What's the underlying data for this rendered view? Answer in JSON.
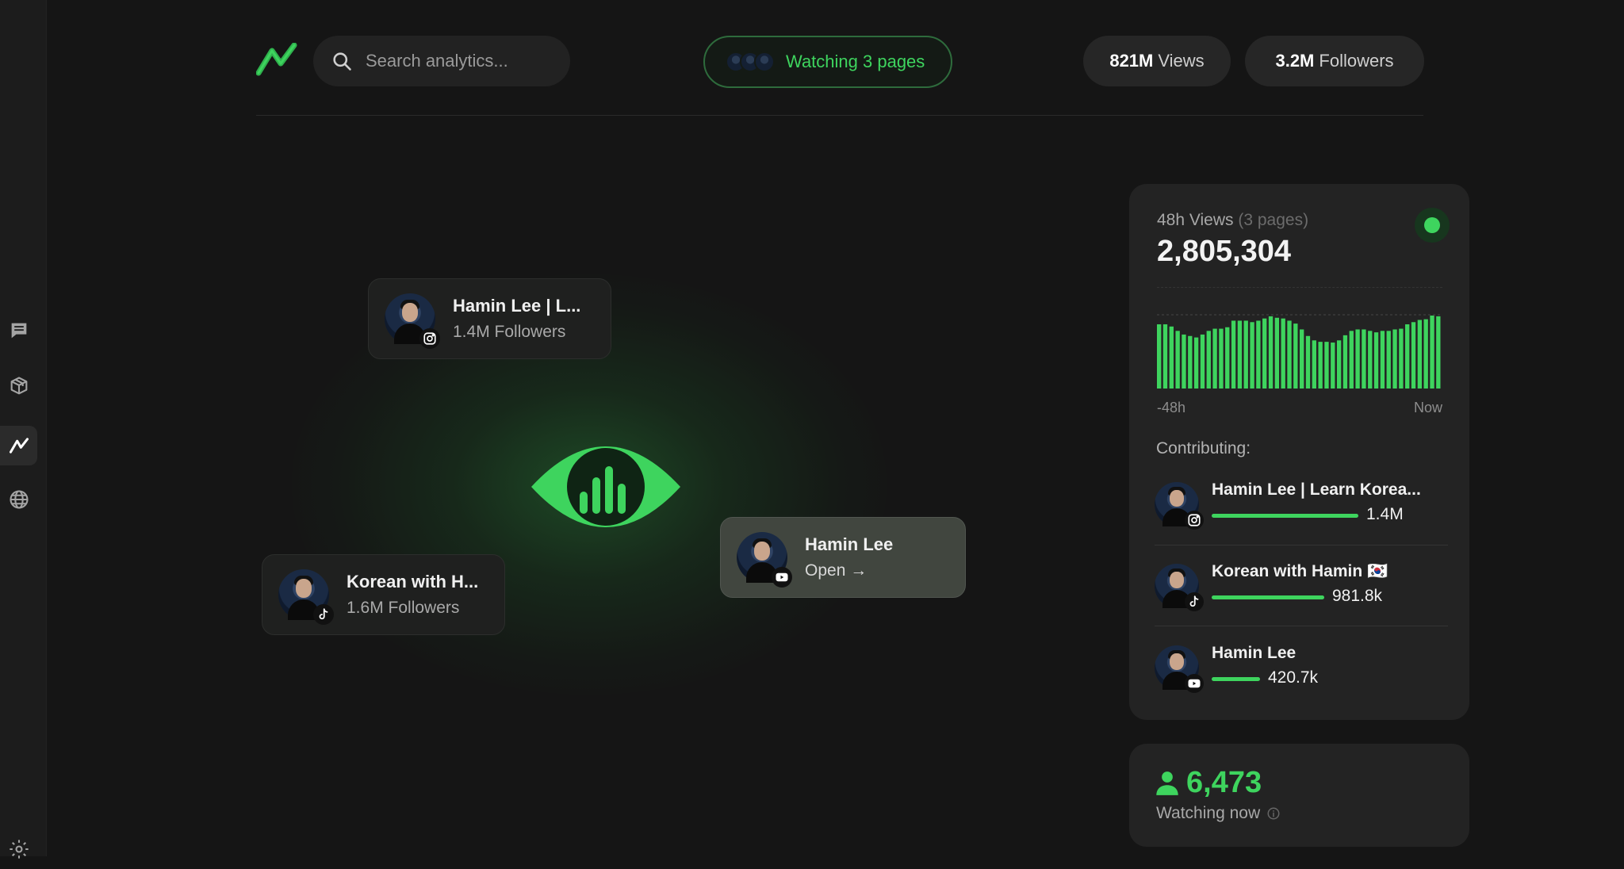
{
  "sidebar": {
    "items": [
      {
        "icon": "chat-icon"
      },
      {
        "icon": "cube-icon"
      },
      {
        "icon": "analytics-icon",
        "active": true
      },
      {
        "icon": "globe-icon"
      },
      {
        "icon": "gear-icon"
      }
    ]
  },
  "header": {
    "search_placeholder": "Search analytics...",
    "watching_label": "Watching 3 pages",
    "views": {
      "value": "821M",
      "label": "Views"
    },
    "followers": {
      "value": "3.2M",
      "label": "Followers"
    }
  },
  "nodes": [
    {
      "title": "Hamin Lee | L...",
      "sub": "1.4M Followers",
      "platform": "instagram-icon"
    },
    {
      "title": "Korean with H...",
      "sub": "1.6M Followers",
      "platform": "tiktok-icon"
    },
    {
      "title": "Hamin Lee",
      "sub": "Open →",
      "platform": "youtube-icon"
    }
  ],
  "panel": {
    "heading": "48h Views",
    "heading_muted": "(3 pages)",
    "total": "2,805,304",
    "axis_start": "-48h",
    "axis_end": "Now",
    "contributing_label": "Contributing:",
    "spark_values": [
      88,
      88,
      85,
      79,
      74,
      72,
      70,
      74,
      79,
      82,
      82,
      84,
      93,
      93,
      93,
      91,
      93,
      96,
      99,
      97,
      96,
      93,
      89,
      81,
      72,
      66,
      64,
      64,
      63,
      66,
      73,
      79,
      81,
      81,
      79,
      77,
      79,
      79,
      81,
      82,
      88,
      91,
      94,
      95,
      100,
      99
    ],
    "contributors": [
      {
        "name": "Hamin Lee | Learn Korea...",
        "value": "1.4M",
        "share": 1.0,
        "platform": "instagram-icon"
      },
      {
        "name": "Korean with Hamin 🇰🇷",
        "value": "981.8k",
        "share": 0.77,
        "platform": "tiktok-icon"
      },
      {
        "name": "Hamin Lee",
        "value": "420.7k",
        "share": 0.33,
        "platform": "youtube-icon"
      }
    ]
  },
  "now": {
    "count": "6,473",
    "label": "Watching now"
  },
  "colors": {
    "accent": "#3ed45e",
    "background": "#151515",
    "card": "#232323"
  }
}
